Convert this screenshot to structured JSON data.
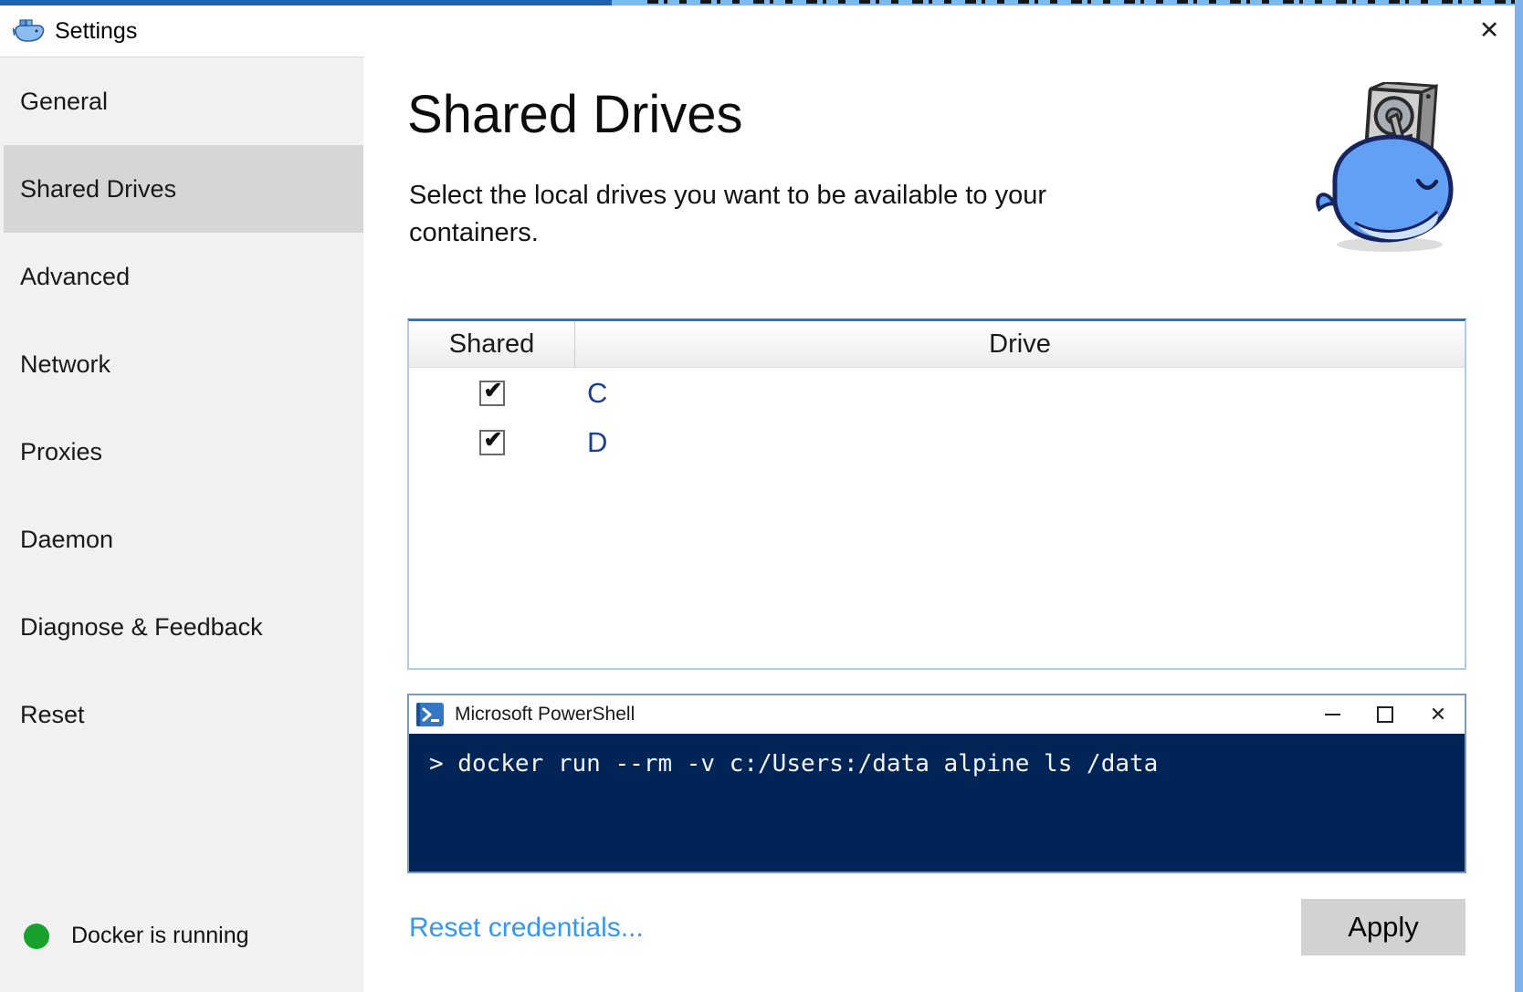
{
  "window": {
    "title": "Settings",
    "close_icon": "✕"
  },
  "sidebar": {
    "items": [
      {
        "label": "General",
        "selected": false
      },
      {
        "label": "Shared Drives",
        "selected": true
      },
      {
        "label": "Advanced",
        "selected": false
      },
      {
        "label": "Network",
        "selected": false
      },
      {
        "label": "Proxies",
        "selected": false
      },
      {
        "label": "Daemon",
        "selected": false
      },
      {
        "label": "Diagnose & Feedback",
        "selected": false
      },
      {
        "label": "Reset",
        "selected": false
      }
    ],
    "status": {
      "text": "Docker is running",
      "dot_color": "#18a12c"
    }
  },
  "main": {
    "heading": "Shared Drives",
    "description": "Select the local drives you want to be available to your containers.",
    "table": {
      "columns": [
        "Shared",
        "Drive"
      ],
      "rows": [
        {
          "drive": "C",
          "shared": true
        },
        {
          "drive": "D",
          "shared": true
        }
      ]
    },
    "powershell": {
      "title": "Microsoft PowerShell",
      "command": "> docker run --rm -v c:/Users:/data alpine ls /data",
      "close_icon": "✕"
    },
    "footer": {
      "reset_link": "Reset credentials...",
      "apply_label": "Apply"
    }
  },
  "icons": {
    "checkmark": "✔"
  },
  "colors": {
    "accent_table_top": "#2e76ba",
    "table_border": "#b1cce4",
    "terminal_bg": "#012456",
    "link_blue": "#3498f2",
    "status_green": "#18a12c",
    "drive_letter_blue": "#17418f",
    "selected_item_bg": "#d6d6d6",
    "apply_bg": "#d2d2d2",
    "powershell_border": "#7d9cb7",
    "artifact_dark_blue": "#2061ad",
    "artifact_light_blue": "#7cb9ed"
  }
}
